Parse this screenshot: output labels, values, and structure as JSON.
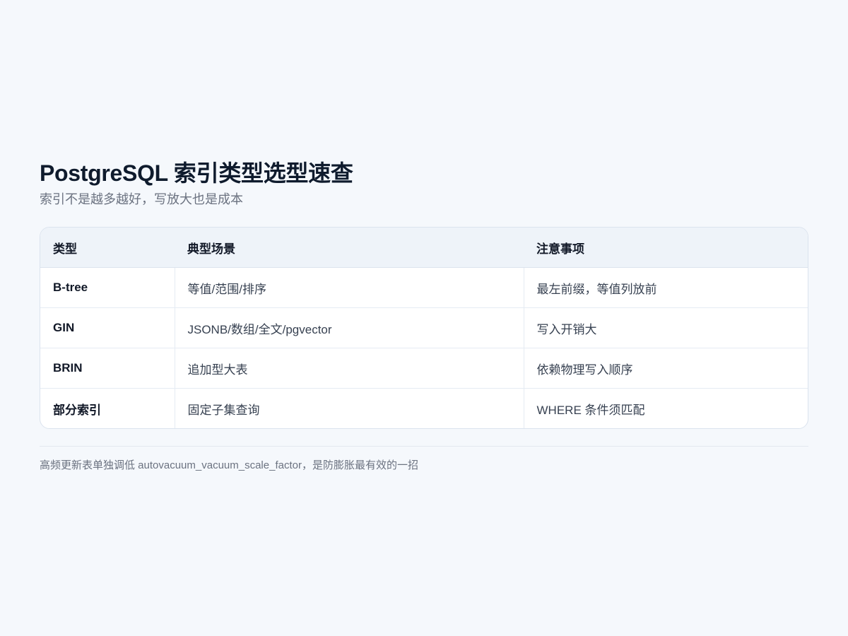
{
  "header": {
    "title": "PostgreSQL 索引类型选型速查",
    "subtitle": "索引不是越多越好，写放大也是成本"
  },
  "table": {
    "columns": [
      "类型",
      "典型场景",
      "注意事项"
    ],
    "rows": [
      {
        "type": "B-tree",
        "scenario": "等值/范围/排序",
        "notes": "最左前缀，等值列放前"
      },
      {
        "type": "GIN",
        "scenario": "JSONB/数组/全文/pgvector",
        "notes": "写入开销大"
      },
      {
        "type": "BRIN",
        "scenario": "追加型大表",
        "notes": "依赖物理写入顺序"
      },
      {
        "type": "部分索引",
        "scenario": "固定子集查询",
        "notes": "WHERE 条件须匹配"
      }
    ]
  },
  "footer": {
    "note": "高频更新表单独调低 autovacuum_vacuum_scale_factor，是防膨胀最有效的一招"
  }
}
